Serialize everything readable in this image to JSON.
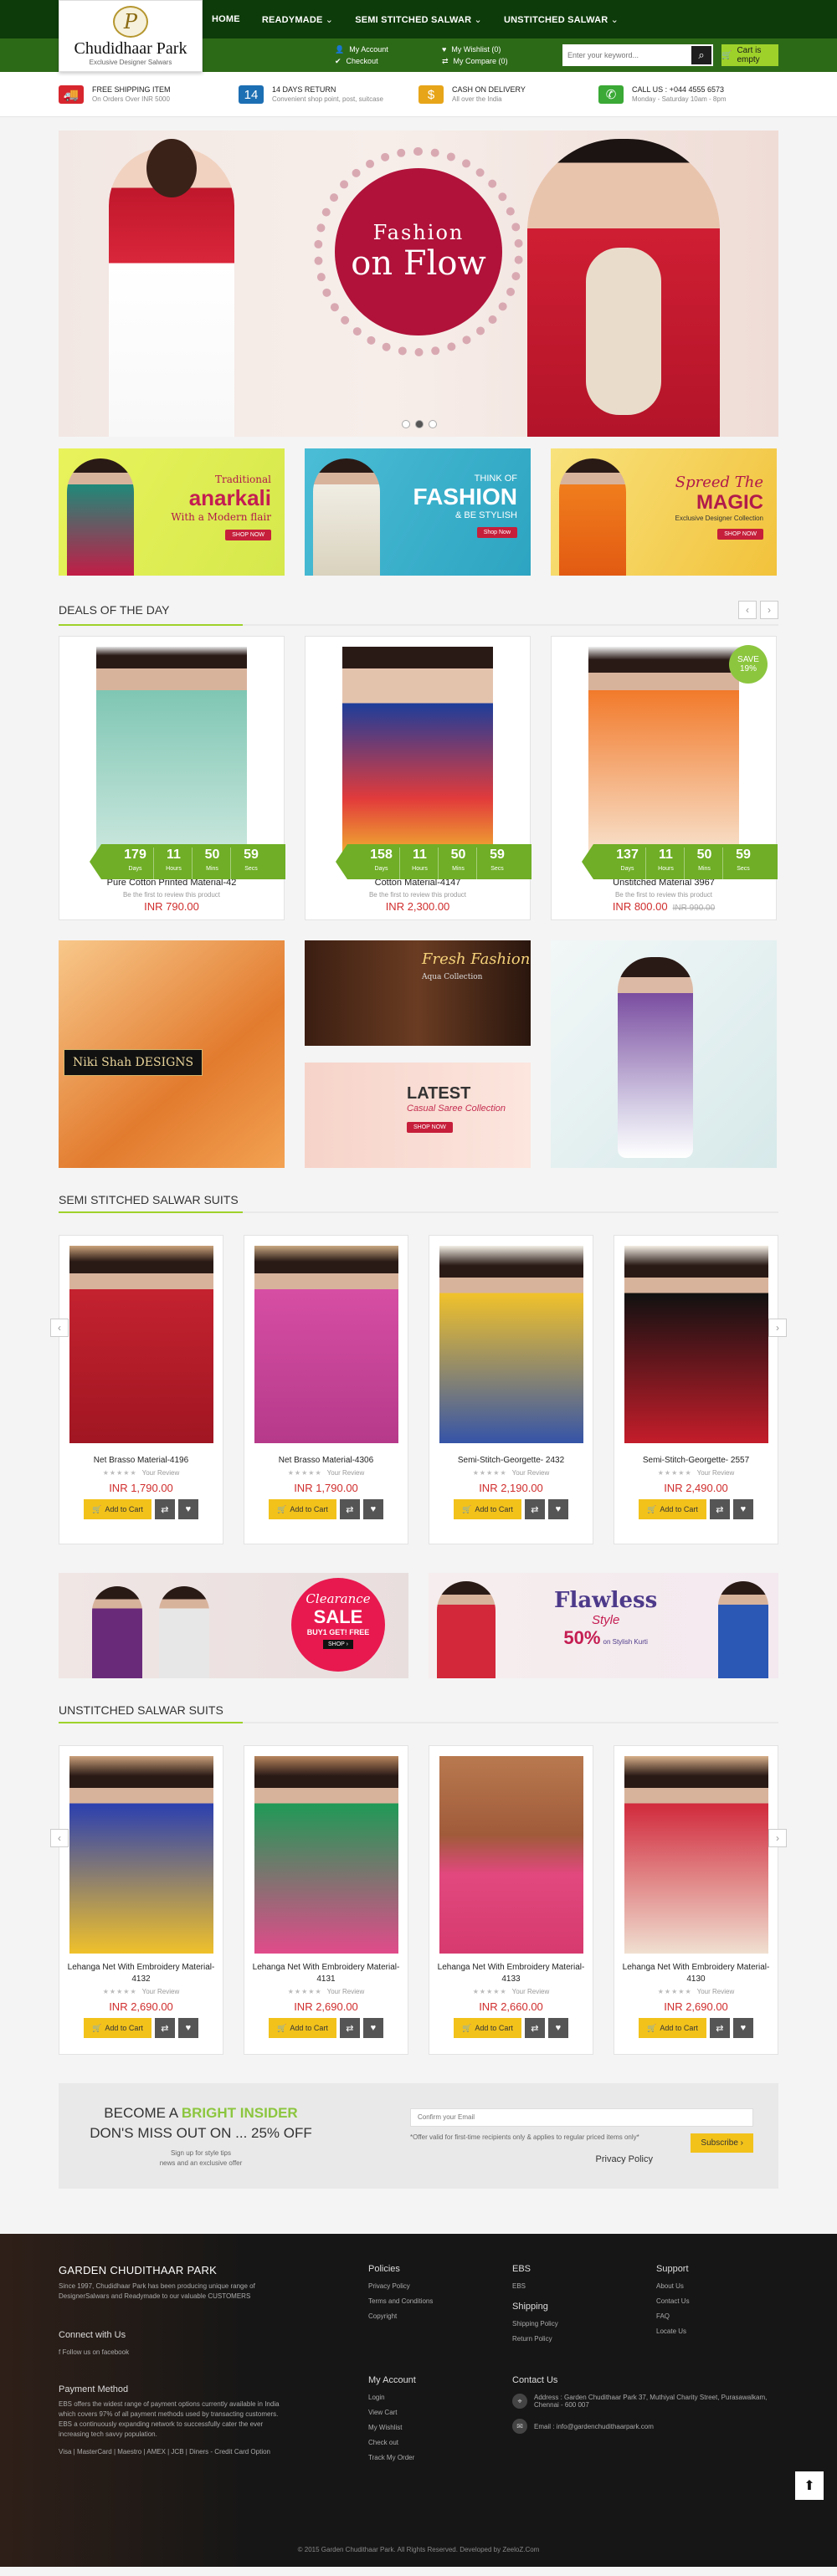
{
  "header": {
    "logo_name": "Chudidhaar Park",
    "logo_tag": "Exclusive Designer Salwars",
    "nav": [
      {
        "label": "HOME"
      },
      {
        "label": "READYMADE"
      },
      {
        "label": "SEMI STITCHED SALWAR"
      },
      {
        "label": "UNSTITCHED SALWAR"
      }
    ],
    "account": {
      "my_account": "My Account",
      "wishlist": "My Wishlist (0)",
      "checkout": "Checkout",
      "compare": "My Compare (0)"
    },
    "search_placeholder": "Enter your keyword...",
    "cart_label": "Cart is empty"
  },
  "features": [
    {
      "title": "FREE SHIPPING ITEM",
      "sub": "On Orders Over INR 5000",
      "icon": "truck-icon",
      "color": "#d7262e"
    },
    {
      "title": "14 DAYS RETURN",
      "sub": "Convenient shop point, post, suitcase",
      "icon": "calendar-icon",
      "color": "#1d6fb3"
    },
    {
      "title": "CASH ON DELIVERY",
      "sub": "All over the India",
      "icon": "cash-icon",
      "color": "#e7a519"
    },
    {
      "title": "CALL US : +044 4555 6573",
      "sub": "Monday - Saturday 10am - 8pm",
      "icon": "phone-icon",
      "color": "#3aa935"
    }
  ],
  "hero": {
    "line1": "Fashion",
    "line2": "on Flow"
  },
  "promos": [
    {
      "a": "Traditional",
      "b": "anarkali",
      "c": "With a Modern flair",
      "btn": "SHOP NOW"
    },
    {
      "a": "THINK OF",
      "b": "FASHION",
      "c": "& BE STYLISH",
      "btn": "Shop Now"
    },
    {
      "a": "Spreed The",
      "b": "MAGIC",
      "c": "Exclusive Designer Collection",
      "btn": "SHOP NOW"
    }
  ],
  "deals": {
    "title": "DEALS OF THE DAY",
    "cd_labels": {
      "days": "Days",
      "hours": "Hours",
      "mins": "Mins",
      "secs": "Secs"
    },
    "items": [
      {
        "name": "Pure Cotton Printed Material-42",
        "review": "Be the first to review this product",
        "price": "INR 790.00",
        "old": "",
        "d": "179",
        "h": "11",
        "m": "50",
        "s": "59"
      },
      {
        "name": "Cotton Material-4147",
        "review": "Be the first to review this product",
        "price": "INR 2,300.00",
        "old": "",
        "d": "158",
        "h": "11",
        "m": "50",
        "s": "59"
      },
      {
        "name": "Unstitched Material 3967",
        "review": "Be the first to review this product",
        "price": "INR 800.00",
        "old": "INR 990.00",
        "d": "137",
        "h": "11",
        "m": "50",
        "s": "59",
        "save_label": "SAVE",
        "save_pct": "19%"
      }
    ]
  },
  "mosaic": {
    "m1": "Niki Shah DESIGNS",
    "m2_title": "Fresh Fashion",
    "m2_sub": "Aqua Collection",
    "m3_title": "LATEST",
    "m3_sub": "Casual Saree Collection",
    "m3_btn": "SHOP NOW"
  },
  "semi": {
    "title": "SEMI STITCHED SALWAR SUITS",
    "items": [
      {
        "name": "Net Brasso Material-4196",
        "price": "INR 1,790.00"
      },
      {
        "name": "Net Brasso Material-4306",
        "price": "INR 1,790.00"
      },
      {
        "name": "Semi-Stitch-Georgette- 2432",
        "price": "INR 2,190.00"
      },
      {
        "name": "Semi-Stitch-Georgette- 2557",
        "price": "INR 2,490.00"
      }
    ]
  },
  "product_common": {
    "review": "Your Review",
    "stars": "★★★★★",
    "add": "Add to Cart"
  },
  "banners": {
    "clear_a": "Clearance",
    "clear_b": "SALE",
    "clear_c": "BUY1 GET! FREE",
    "clear_btn": "SHOP ›",
    "flaw_a": "Flawless",
    "flaw_b": "Style",
    "flaw_pct": "50%",
    "flaw_sub": "on Stylish Kurti"
  },
  "unst": {
    "title": "UNSTITCHED SALWAR SUITS",
    "items": [
      {
        "name": "Lehanga Net With Embroidery Material-4132",
        "price": "INR 2,690.00"
      },
      {
        "name": "Lehanga Net With Embroidery Material-4131",
        "price": "INR 2,690.00"
      },
      {
        "name": "Lehanga Net With Embroidery Material-4133",
        "price": "INR 2,660.00"
      },
      {
        "name": "Lehanga Net With Embroidery Material-4130",
        "price": "INR 2,690.00"
      }
    ]
  },
  "newsletter": {
    "pre": "BECOME A",
    "hl": "BRIGHT INSIDER",
    "line2": "DON'S MISS OUT ON ... 25% OFF",
    "p1": "Sign up for style tips",
    "p2": "news and an exclusive offer",
    "placeholder": "Confirm your Email",
    "note": "*Offer valid for first-time recipients only & applies to regular priced items only*",
    "privacy": "Privacy Policy",
    "subscribe": "Subscribe"
  },
  "footer": {
    "brand": "GARDEN CHUDITHAAR PARK",
    "about": "Since 1997, Chudidhaar Park has been producing unique range of DesignerSalwars and Readymade to our valuable CUSTOMERS",
    "connect": "Connect with Us",
    "follow": "Follow us on facebook",
    "payment": "Payment Method",
    "payment_text": "EBS offers the widest range of payment options currently available in India which covers 97% of all payment methods used by transacting customers. EBS a continuously expanding network to successfully cater the ever increasing tech savvy population.",
    "cards": "Visa | MasterCard | Maestro | AMEX | JCB | Diners - Credit Card Option",
    "policies": {
      "title": "Policies",
      "items": [
        "Privacy Policy",
        "Terms and Conditions",
        "Copyright"
      ]
    },
    "ebs": {
      "title": "EBS",
      "items": [
        "EBS"
      ]
    },
    "support": {
      "title": "Support",
      "items": [
        "About Us",
        "Contact Us",
        "FAQ",
        "Locate Us"
      ]
    },
    "shipping": {
      "title": "Shipping",
      "items": [
        "Shipping Policy",
        "Return Policy"
      ]
    },
    "myacct": {
      "title": "My Account",
      "items": [
        "Login",
        "View Cart",
        "My Wishlist",
        "Check out",
        "Track My Order"
      ]
    },
    "contact": {
      "title": "Contact Us",
      "address": "Address : Garden Chudithaar Park 37, Muthiyal Charity Street, Purasawalkam, Chennai - 600 007",
      "email": "Email : info@gardenchudithaarpark.com"
    },
    "copyright": "© 2015 Garden Chudithaar Park. All Rights Reserved. Developed by ZeeloZ.Com"
  }
}
